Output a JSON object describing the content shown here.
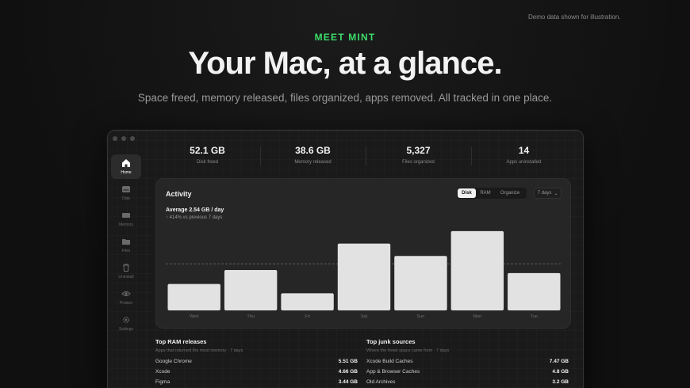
{
  "demo_note": "Demo data shown for illustration.",
  "eyebrow": "MEET MINT",
  "headline": "Your Mac, at a glance.",
  "subline": "Space freed, memory released, files organized, apps removed. All tracked in one place.",
  "sidebar": {
    "items": [
      {
        "label": "Home",
        "icon": "home-icon",
        "active": true
      },
      {
        "label": "Disk",
        "icon": "disk-icon"
      },
      {
        "label": "Memory",
        "icon": "memory-icon"
      },
      {
        "label": "Files",
        "icon": "folder-icon"
      },
      {
        "label": "Uninstall",
        "icon": "trash-icon"
      },
      {
        "label": "Protect",
        "icon": "eye-icon"
      },
      {
        "label": "Settings",
        "icon": "gear-icon"
      }
    ]
  },
  "stats": [
    {
      "value": "52.1 GB",
      "label": "Disk freed"
    },
    {
      "value": "38.6 GB",
      "label": "Memory released"
    },
    {
      "value": "5,327",
      "label": "Files organized"
    },
    {
      "value": "14",
      "label": "Apps uninstalled"
    }
  ],
  "activity": {
    "title": "Activity",
    "tabs": [
      "Disk",
      "RAM",
      "Organize"
    ],
    "selected_tab": "Disk",
    "period": "7 days",
    "average": "Average 2.54 GB / day",
    "delta": "↑ 414% vs previous 7 days"
  },
  "chart_data": {
    "type": "bar",
    "categories": [
      "Wed",
      "Thu",
      "Fri",
      "Sat",
      "Sun",
      "Mon",
      "Tue"
    ],
    "values": [
      1.7,
      2.6,
      1.1,
      4.3,
      3.5,
      5.1,
      2.4
    ],
    "average_line": 3.0,
    "ylim": [
      0,
      5.4
    ],
    "bar_color": "#e2e2e2",
    "xlabel": "",
    "ylabel": "",
    "title": ""
  },
  "ram_list": {
    "title": "Top RAM releases",
    "subtitle": "Apps that returned the most memory · 7 days",
    "rows": [
      {
        "name": "Google Chrome",
        "value": "5.51 GB"
      },
      {
        "name": "Xcode",
        "value": "4.66 GB"
      },
      {
        "name": "Figma",
        "value": "3.44 GB"
      }
    ]
  },
  "junk_list": {
    "title": "Top junk sources",
    "subtitle": "Where the freed space came from · 7 days",
    "rows": [
      {
        "name": "Xcode Build Caches",
        "value": "7.47 GB"
      },
      {
        "name": "App & Browser Caches",
        "value": "4.8 GB"
      },
      {
        "name": "Old Archives",
        "value": "3.2 GB"
      }
    ]
  },
  "colors": {
    "accent": "#3ddc6a",
    "bg": "#121212",
    "panel": "#262626"
  }
}
